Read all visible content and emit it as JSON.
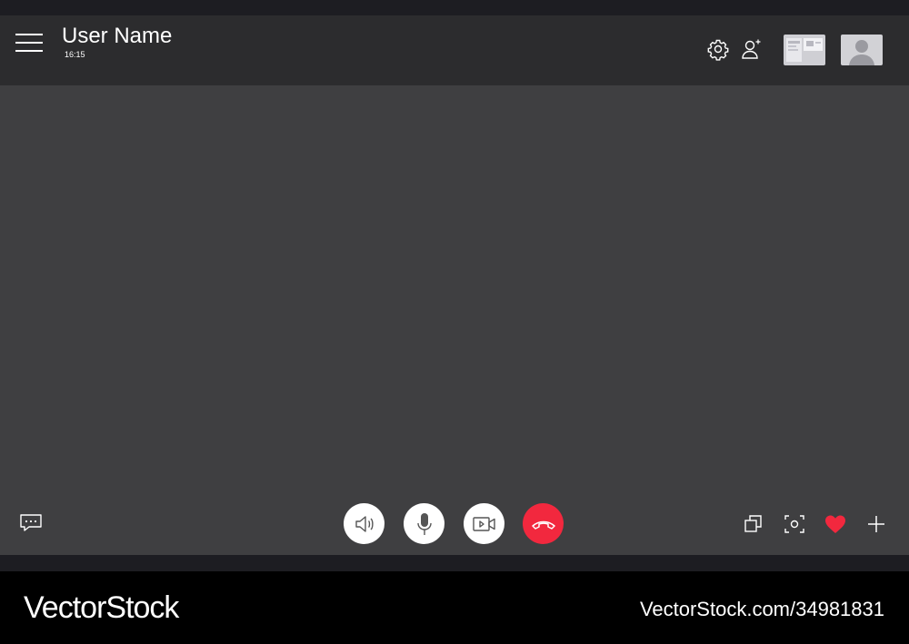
{
  "header": {
    "user_name": "User Name",
    "time": "16:15",
    "icons": [
      "menu-icon",
      "settings-icon",
      "add-user-icon"
    ],
    "thumbnails": [
      "screen-share-thumbnail",
      "participant-avatar-thumbnail"
    ]
  },
  "controls": {
    "left": [
      "chat-icon"
    ],
    "center": [
      "speaker-icon",
      "microphone-icon",
      "video-camera-icon",
      "hang-up-icon"
    ],
    "right": [
      "picture-in-picture-icon",
      "screenshot-icon",
      "heart-icon",
      "plus-icon"
    ]
  },
  "colors": {
    "header_bg": "#2c2c2e",
    "main_bg": "#3f3f41",
    "hang_up": "#f2283e",
    "heart": "#f2283e"
  },
  "watermark": {
    "brand": "VectorStock",
    "url": "VectorStock.com/34981831"
  }
}
